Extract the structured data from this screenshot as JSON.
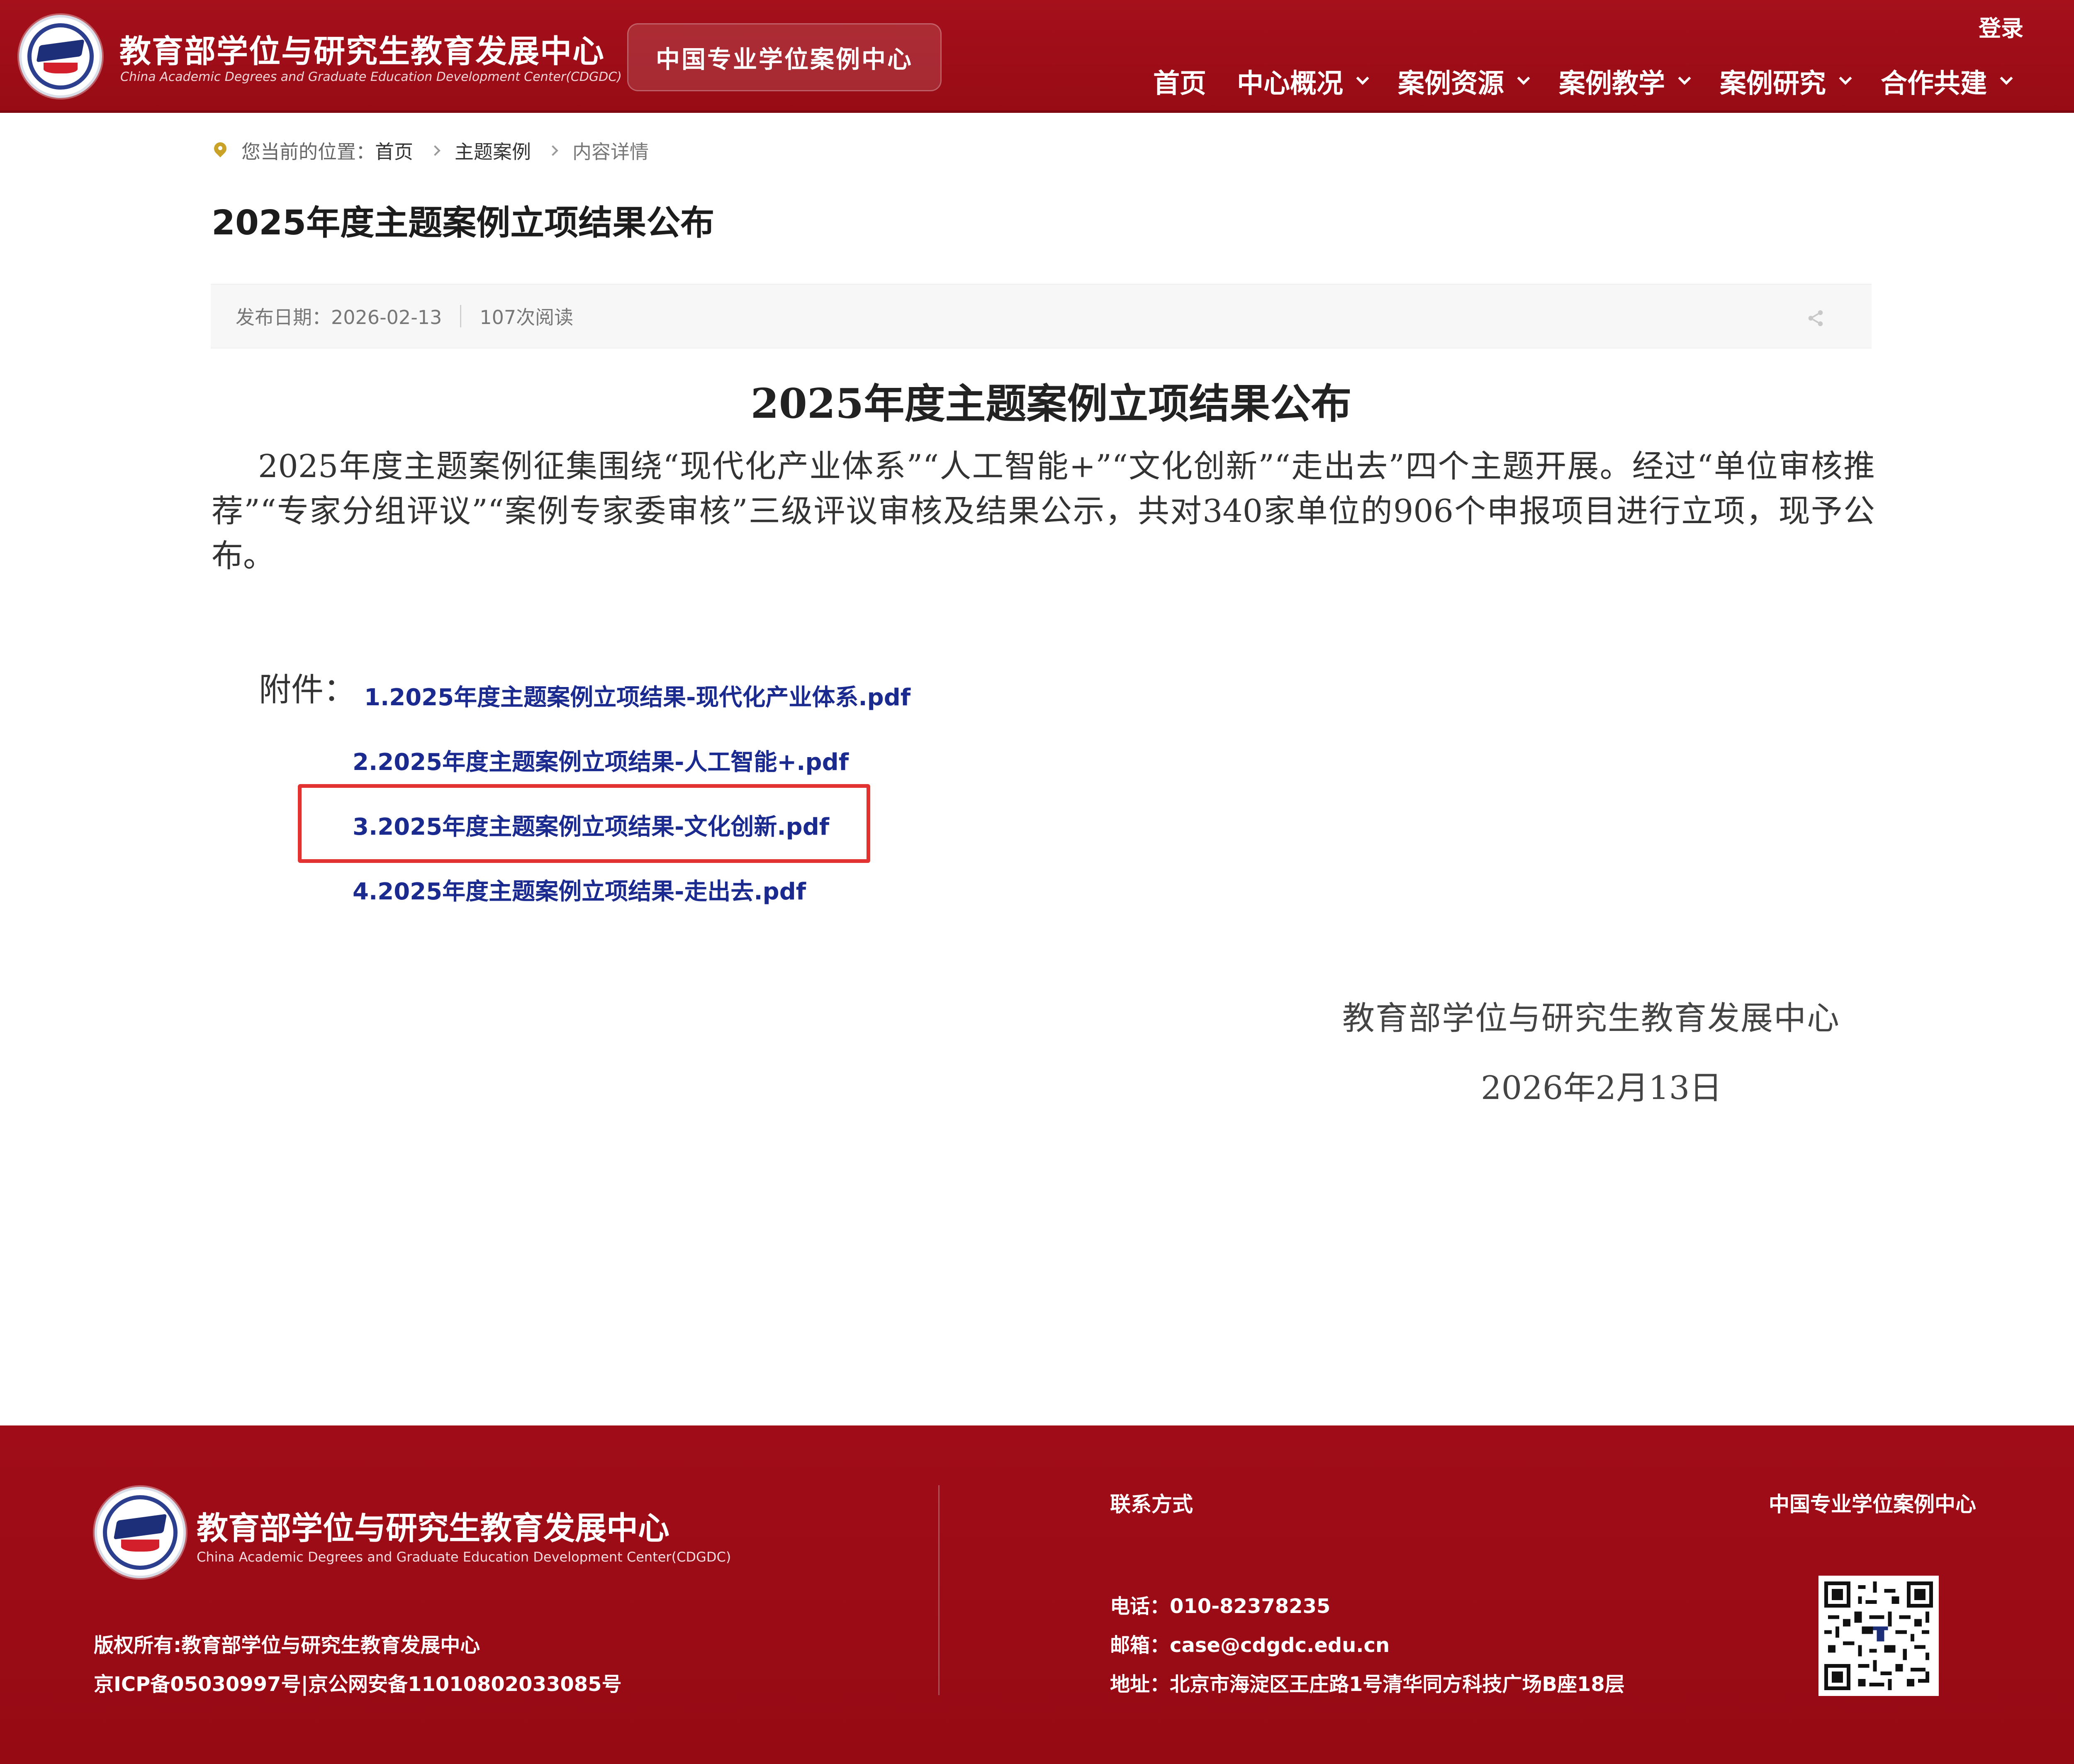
{
  "header": {
    "org_name_cn": "教育部学位与研究生教育发展中心",
    "org_name_en": "China Academic Degrees and Graduate Education Development Center(CDGDC)",
    "case_center_badge": "中国专业学位案例中心",
    "login_label": "登录",
    "nav": [
      {
        "label": "首页",
        "has_dropdown": false
      },
      {
        "label": "中心概况",
        "has_dropdown": true
      },
      {
        "label": "案例资源",
        "has_dropdown": true
      },
      {
        "label": "案例教学",
        "has_dropdown": true
      },
      {
        "label": "案例研究",
        "has_dropdown": true
      },
      {
        "label": "合作共建",
        "has_dropdown": true
      }
    ]
  },
  "breadcrumb": {
    "prefix": "您当前的位置：",
    "items": [
      "首页",
      "主题案例",
      "内容详情"
    ]
  },
  "page_title": "2025年度主题案例立项结果公布",
  "meta": {
    "publish_date": "发布日期：2026-02-13",
    "reads": "107次阅读",
    "share_icon": "share-icon"
  },
  "article": {
    "heading": "2025年度主题案例立项结果公布",
    "body": "2025年度主题案例征集围绕“现代化产业体系”“人工智能+”“文化创新”“走出去”四个主题开展。经过“单位审核推荐”“专家分组评议”“案例专家委审核”三级评议审核及结果公示，共对340家单位的906个申报项目进行立项，现予公布。",
    "attachments_label": "附件：",
    "attachments": [
      "1.2025年度主题案例立项结果-现代化产业体系.pdf",
      "2.2025年度主题案例立项结果-人工智能+.pdf",
      "3.2025年度主题案例立项结果-文化创新.pdf",
      "4.2025年度主题案例立项结果-走出去.pdf"
    ],
    "highlighted_attachment_index": 2,
    "signature_org": "教育部学位与研究生教育发展中心",
    "signature_date": "2026年2月13日"
  },
  "footer": {
    "org_name_cn": "教育部学位与研究生教育发展中心",
    "org_name_en": "China Academic Degrees and Graduate Education Development Center(CDGDC)",
    "copyright": "版权所有:教育部学位与研究生教育发展中心",
    "icp": "京ICP备05030997号|京公网安备11010802033085号",
    "contact_heading": "联系方式",
    "phone": "电话：010-82378235",
    "email": "邮箱：case@cdgdc.edu.cn",
    "address": "地址：北京市海淀区王庄路1号清华同方科技广场B座18层",
    "case_center_heading": "中国专业学位案例中心",
    "qr_icon": "qr-code-icon"
  },
  "colors": {
    "brand_red": "#a5101b",
    "link_blue": "#1b2a8f",
    "highlight_red": "#e33232",
    "pin_gold": "#c9a227"
  }
}
